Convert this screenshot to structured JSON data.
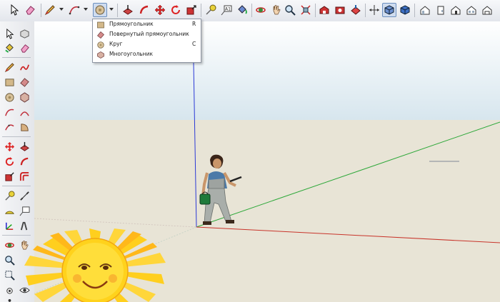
{
  "window": {
    "title": ""
  },
  "toolbar": {
    "items": [
      {
        "name": "select-tool",
        "icon": "arrow-cursor-icon"
      },
      {
        "name": "eraser-tool",
        "icon": "eraser-icon"
      },
      {
        "name": "pencil-tool",
        "icon": "pencil-icon"
      },
      {
        "name": "arc-tool",
        "icon": "arc-icon"
      },
      {
        "name": "shapes-tool",
        "icon": "circle-shape-icon",
        "active": true
      },
      {
        "name": "push-pull-tool",
        "icon": "push-pull-icon"
      },
      {
        "name": "follow-me-tool",
        "icon": "follow-me-icon"
      },
      {
        "name": "move-tool",
        "icon": "move-icon"
      },
      {
        "name": "rotate-tool",
        "icon": "rotate-icon"
      },
      {
        "name": "scale-tool",
        "icon": "scale-icon"
      },
      {
        "name": "tape-measure-tool",
        "icon": "tape-measure-icon"
      },
      {
        "name": "text-tool",
        "icon": "text-label-icon"
      },
      {
        "name": "paint-bucket-tool",
        "icon": "paint-bucket-icon"
      },
      {
        "name": "orbit-tool",
        "icon": "orbit-icon"
      },
      {
        "name": "pan-tool",
        "icon": "hand-icon"
      },
      {
        "name": "zoom-tool",
        "icon": "magnifier-icon"
      },
      {
        "name": "zoom-extents-tool",
        "icon": "zoom-extents-icon"
      },
      {
        "name": "warehouse-tool",
        "icon": "warehouse-icon"
      },
      {
        "name": "extension-tool",
        "icon": "extension-icon"
      },
      {
        "name": "share-tool",
        "icon": "share-icon"
      },
      {
        "name": "axes-view",
        "icon": "axes-icon"
      },
      {
        "name": "iso-view",
        "icon": "iso-cube-icon"
      },
      {
        "name": "top-view",
        "icon": "top-cube-icon"
      },
      {
        "name": "front-view",
        "icon": "house-front-icon"
      },
      {
        "name": "right-view",
        "icon": "house-right-icon"
      },
      {
        "name": "back-view",
        "icon": "house-back-icon"
      },
      {
        "name": "left-view",
        "icon": "house-left-icon"
      }
    ]
  },
  "shape_menu": {
    "items": [
      {
        "label": "Прямоугольник",
        "shortcut": "R",
        "icon": "rectangle-icon"
      },
      {
        "label": "Повернутый прямоугольник",
        "shortcut": "",
        "icon": "rotated-rectangle-icon"
      },
      {
        "label": "Круг",
        "shortcut": "C",
        "icon": "circle-icon"
      },
      {
        "label": "Многоугольник",
        "shortcut": "",
        "icon": "polygon-icon"
      }
    ]
  },
  "colors": {
    "sky_top": "#ffffff",
    "sky_horizon": "#d7e6ee",
    "ground": "#e8e4d6",
    "axis_red": "#c8342a",
    "axis_green": "#2ea83a",
    "axis_blue": "#2b39d6",
    "sun": "#ffd21c"
  }
}
